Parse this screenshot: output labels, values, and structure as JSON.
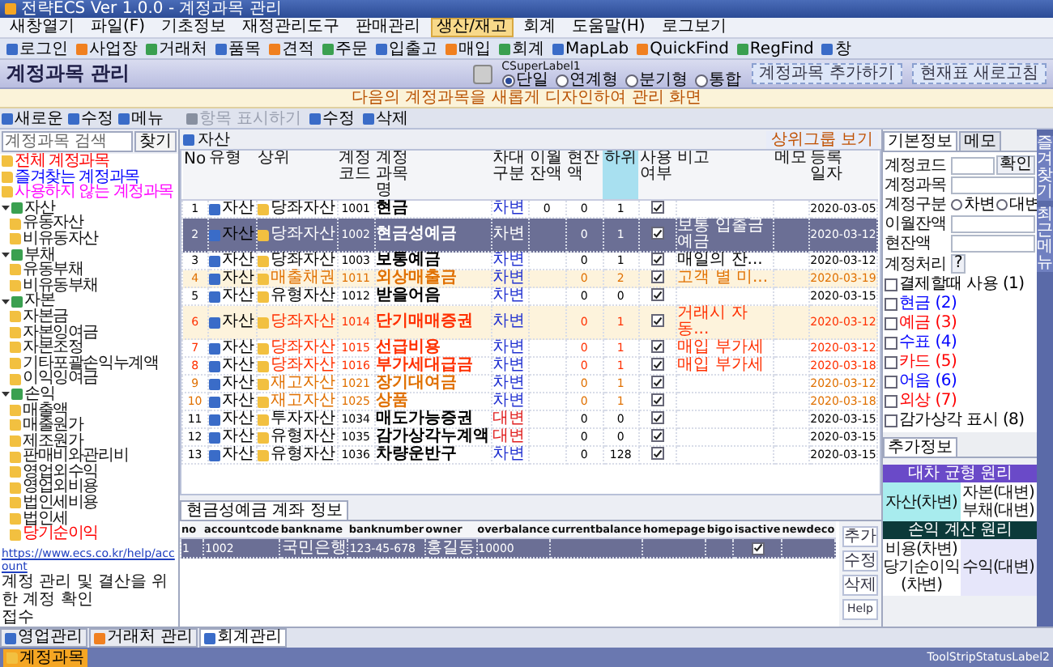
{
  "window": {
    "title": "전략ECS Ver 1.0.0 - 계정과목 관리"
  },
  "menu": [
    {
      "label": "새창열기",
      "selected": false
    },
    {
      "label": "파일(F)",
      "selected": false
    },
    {
      "label": "기초정보",
      "selected": false
    },
    {
      "label": "재정관리도구",
      "selected": false
    },
    {
      "label": "판매관리",
      "selected": false
    },
    {
      "label": "생산/재고",
      "selected": true
    },
    {
      "label": "회계",
      "selected": false
    },
    {
      "label": "도움말(H)",
      "selected": false
    },
    {
      "label": "로그보기",
      "selected": false
    }
  ],
  "toolbar": [
    "로그인",
    "사업장",
    "거래처",
    "품목",
    "견적",
    "주문",
    "입출고",
    "매입",
    "회계",
    "MapLab",
    "QuickFind",
    "RegFind",
    "창"
  ],
  "header": {
    "title": "계정과목 관리",
    "label": "CSuperLabel1",
    "radios": [
      {
        "label": "단일",
        "selected": true
      },
      {
        "label": "연계형",
        "selected": false
      },
      {
        "label": "분기형",
        "selected": false
      },
      {
        "label": "통합",
        "selected": false
      }
    ],
    "buttons": [
      "계정과목 추가하기",
      "현재표 새로고침"
    ]
  },
  "notice": "다음의 계정과목을 새롭게 디자인하여 관리 화면",
  "left_toolbar": [
    "새로운",
    "수정",
    "메뉴"
  ],
  "main_toolbar": [
    {
      "label": "항목 표시하기",
      "disabled": true
    },
    {
      "label": "수정",
      "disabled": false
    },
    {
      "label": "삭제",
      "disabled": false
    }
  ],
  "sidebar": {
    "search": {
      "placeholder": "계정과목 검색"
    },
    "search_button": "찾기",
    "tree": [
      {
        "label": "전체 계정과목",
        "color": "#ff0000"
      },
      {
        "label": "즐겨찾는 계정과목",
        "color": "#0000ff"
      },
      {
        "label": "사용하지 않는 계정과목",
        "color": "#ff00ff"
      },
      {
        "label": "자산",
        "expanded": true,
        "children": [
          {
            "label": "유동자산"
          },
          {
            "label": "비유동자산"
          }
        ]
      },
      {
        "label": "부채",
        "expanded": true,
        "children": [
          {
            "label": "유동부채"
          },
          {
            "label": "비유동부채"
          }
        ]
      },
      {
        "label": "자본",
        "expanded": true,
        "children": [
          {
            "label": "자본금"
          },
          {
            "label": "자본잉여금"
          },
          {
            "label": "자본조정"
          },
          {
            "label": "기타포괄손익누계액"
          },
          {
            "label": "이익잉여금"
          }
        ]
      },
      {
        "label": "손익",
        "expanded": true,
        "children": [
          {
            "label": "매출액"
          },
          {
            "label": "매출원가"
          },
          {
            "label": "제조원가"
          },
          {
            "label": "판매비와관리비"
          },
          {
            "label": "영업외수익"
          },
          {
            "label": "영업외비용"
          },
          {
            "label": "법인세비용"
          },
          {
            "label": "법인세"
          },
          {
            "label": "당기순이익",
            "color": "#ff0000"
          }
        ]
      }
    ],
    "link": "https://www.ecs.co.kr/help/account",
    "description": "계정 관리 및 결산을 위한 계정 확인",
    "footer": "접수"
  },
  "table": {
    "caption": "자산",
    "button": "상위그룹 보기",
    "columns": [
      {
        "label": "No",
        "sorted": false
      },
      {
        "label": "유형",
        "sorted": false
      },
      {
        "label": "상위",
        "sorted": false
      },
      {
        "label": "계정코드",
        "sorted": false
      },
      {
        "label": "계정과목명",
        "sorted": false
      },
      {
        "label": "차대구분",
        "sorted": false
      },
      {
        "label": "이월잔액",
        "sorted": false
      },
      {
        "label": "현잔액",
        "sorted": false
      },
      {
        "label": "하위",
        "sorted": true
      },
      {
        "label": "사용여부",
        "sorted": false
      },
      {
        "label": "비고",
        "sorted": false
      },
      {
        "label": "메모",
        "sorted": false
      },
      {
        "label": "등록일자",
        "sorted": false
      }
    ],
    "rows": [
      {
        "no": "1",
        "type": "자산",
        "parent": "당좌자산",
        "code": "1001",
        "name": "현금",
        "side": "차변",
        "kind": "debit",
        "carry": "0",
        "balance": "0",
        "sub": "1",
        "used": true,
        "note": "",
        "date": "2020-03-05",
        "selected": false,
        "highlighted": false,
        "color": "#000000"
      },
      {
        "no": "2",
        "type": "자산",
        "parent": "당좌자산",
        "code": "1002",
        "name": "현금성예금",
        "side": "차변",
        "kind": "debit",
        "carry": "",
        "balance": "0",
        "sub": "1",
        "used": true,
        "note": "보통 입출금 예금",
        "date": "2020-03-12",
        "selected": true,
        "highlighted": false
      },
      {
        "no": "3",
        "type": "자산",
        "parent": "당좌자산",
        "code": "1003",
        "name": "보통예금",
        "side": "차변",
        "kind": "debit",
        "carry": "",
        "balance": "0",
        "sub": "1",
        "used": true,
        "note": "매일의 잔...",
        "date": "2020-03-12",
        "selected": false,
        "highlighted": false,
        "color": "#000000"
      },
      {
        "no": "4",
        "type": "자산",
        "parent": "매출채권",
        "code": "1011",
        "name": "외상매출금",
        "side": "차변",
        "kind": "debit",
        "carry": "",
        "balance": "0",
        "sub": "2",
        "used": true,
        "note": "고객 별 미...",
        "date": "2020-03-19",
        "selected": false,
        "highlighted": true,
        "color": "#e07000"
      },
      {
        "no": "5",
        "type": "자산",
        "parent": "유형자산",
        "code": "1012",
        "name": "받을어음",
        "side": "차변",
        "kind": "debit",
        "carry": "",
        "balance": "0",
        "sub": "0",
        "used": true,
        "note": "",
        "date": "2020-03-15",
        "selected": false,
        "highlighted": false,
        "color": "#000000"
      },
      {
        "no": "6",
        "type": "자산",
        "parent": "당좌자산",
        "code": "1014",
        "name": "단기매매증권",
        "side": "차변",
        "kind": "debit",
        "carry": "",
        "balance": "0",
        "sub": "1",
        "used": true,
        "note": "거래시 자동...",
        "date": "2020-03-12",
        "selected": false,
        "highlighted": true,
        "color": "#ff3000"
      },
      {
        "no": "7",
        "type": "자산",
        "parent": "당좌자산",
        "code": "1015",
        "name": "선급비용",
        "side": "차변",
        "kind": "debit",
        "carry": "",
        "balance": "0",
        "sub": "1",
        "used": true,
        "note": "매입 부가세",
        "date": "2020-03-12",
        "selected": false,
        "highlighted": false,
        "color": "#ff3000"
      },
      {
        "no": "8",
        "type": "자산",
        "parent": "당좌자산",
        "code": "1016",
        "name": "부가세대급금",
        "side": "차변",
        "kind": "debit",
        "carry": "",
        "balance": "0",
        "sub": "1",
        "used": true,
        "note": "매입 부가세",
        "date": "2020-03-18",
        "selected": false,
        "highlighted": false,
        "color": "#ff3000"
      },
      {
        "no": "9",
        "type": "자산",
        "parent": "재고자산",
        "code": "1021",
        "name": "장기대여금",
        "side": "차변",
        "kind": "debit",
        "carry": "",
        "balance": "0",
        "sub": "1",
        "used": true,
        "note": "",
        "date": "2020-03-12",
        "selected": false,
        "highlighted": false,
        "color": "#e07000"
      },
      {
        "no": "10",
        "type": "자산",
        "parent": "재고자산",
        "code": "1025",
        "name": "상품",
        "side": "차변",
        "kind": "debit",
        "carry": "",
        "balance": "0",
        "sub": "1",
        "used": true,
        "note": "",
        "date": "2020-03-18",
        "selected": false,
        "highlighted": false,
        "color": "#e07000"
      },
      {
        "no": "11",
        "type": "자산",
        "parent": "투자자산",
        "code": "1034",
        "name": "매도가능증권",
        "side": "대변",
        "kind": "credit",
        "carry": "",
        "balance": "0",
        "sub": "0",
        "used": true,
        "note": "",
        "date": "2020-03-15",
        "selected": false,
        "highlighted": false,
        "color": "#000000"
      },
      {
        "no": "12",
        "type": "자산",
        "parent": "유형자산",
        "code": "1035",
        "name": "감가상각누계액",
        "side": "대변",
        "kind": "credit",
        "carry": "",
        "balance": "0",
        "sub": "0",
        "used": true,
        "note": "",
        "date": "2020-03-15",
        "selected": false,
        "highlighted": false,
        "color": "#000000"
      },
      {
        "no": "13",
        "type": "자산",
        "parent": "유형자산",
        "code": "1036",
        "name": "차량운반구",
        "side": "차변",
        "kind": "debit",
        "carry": "",
        "balance": "0",
        "sub": "128",
        "used": true,
        "note": "",
        "date": "2020-03-15",
        "selected": false,
        "highlighted": false,
        "color": "#000000"
      }
    ]
  },
  "accounts": {
    "tab": "현금성예금 계좌 정보",
    "columns": [
      "no",
      "accountcode",
      "bankname",
      "banknumber",
      "owner",
      "overbalance",
      "currentbalance",
      "homepage",
      "bigo",
      "isactive",
      "newdeco"
    ],
    "rows": [
      {
        "no": "1",
        "accountcode": "1002",
        "bankname": "국민은행",
        "banknumber": "123-45-678",
        "owner": "홍길동",
        "overbalance": "10000",
        "isactive": true,
        "selected": true
      }
    ],
    "buttons": [
      "추가",
      "수정",
      "삭제",
      "Help"
    ]
  },
  "detail": {
    "tabs": [
      {
        "label": "기본정보",
        "selected": true
      },
      {
        "label": "메모",
        "selected": false
      }
    ],
    "fields": [
      {
        "label": "계정코드",
        "button": "확인"
      },
      {
        "label": "계정과목"
      }
    ],
    "side": {
      "label": "계정구분",
      "options": [
        {
          "label": "차변",
          "selected": false
        },
        {
          "label": "대변",
          "selected": false
        }
      ]
    },
    "amounts": [
      {
        "label": "이월잔액"
      },
      {
        "label": "현잔액"
      }
    ],
    "process": {
      "label": "계정처리",
      "button": "?"
    },
    "checks": [
      {
        "label": "결제할때 사용 (1)",
        "checked": false,
        "color": "#000000"
      },
      {
        "label": "현금 (2)",
        "checked": false,
        "color": "#0000ff"
      },
      {
        "label": "예금 (3)",
        "checked": false,
        "color": "#ff0000"
      },
      {
        "label": "수표 (4)",
        "checked": false,
        "color": "#0000ff"
      },
      {
        "label": "카드 (5)",
        "checked": false,
        "color": "#ff0000"
      },
      {
        "label": "어음 (6)",
        "checked": false,
        "color": "#0000ff"
      },
      {
        "label": "외상 (7)",
        "checked": false,
        "color": "#ff0000"
      },
      {
        "label": "감가상각 표시 (8)",
        "checked": false,
        "color": "#000000"
      }
    ]
  },
  "extra": {
    "tab": "추가정보",
    "sections": [
      {
        "kind": "balance",
        "title": "대차 균형 원리",
        "left": [
          "자산(차변)"
        ],
        "right": [
          "자본(대변)",
          "부채(대변)"
        ]
      },
      {
        "kind": "income",
        "title": "손익 계산 원리",
        "left": [
          "비용(차변)",
          "당기순이익(차변)"
        ],
        "right": [
          "수익(대변)"
        ]
      }
    ]
  },
  "dock": [
    "즐겨찾기",
    "최근메뉴"
  ],
  "bottom_tabs": [
    {
      "label": "영업관리",
      "selected": false
    },
    {
      "label": "거래처 관리",
      "selected": false
    },
    {
      "label": "회계관리",
      "selected": true
    }
  ],
  "taskbar": [
    {
      "label": "계정과목",
      "selected": true
    }
  ],
  "status_bar": "ToolStripStatusLabel2"
}
